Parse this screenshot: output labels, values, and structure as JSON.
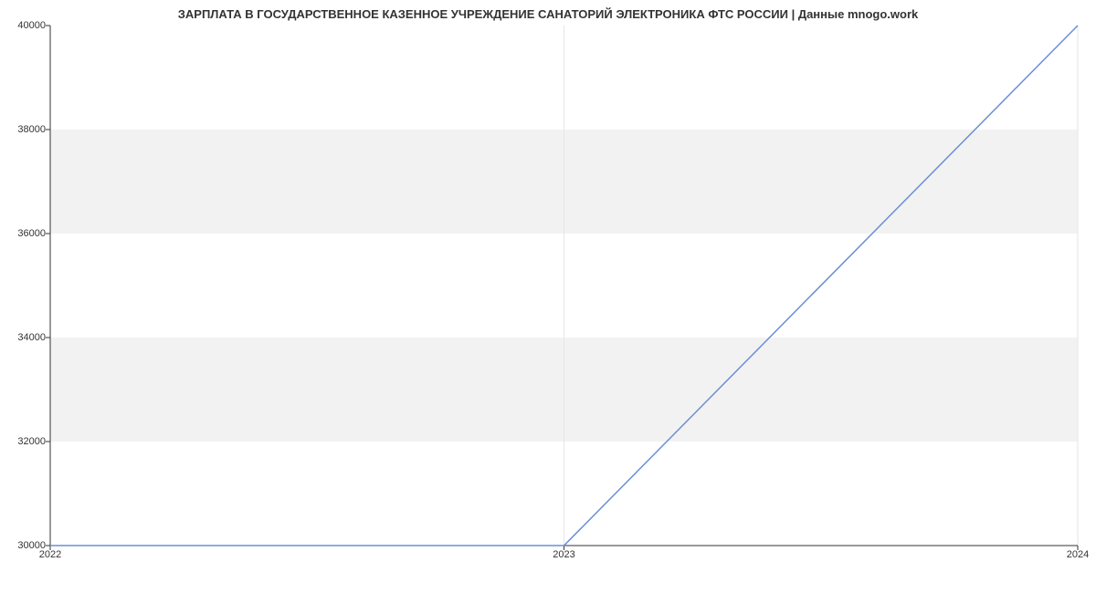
{
  "chart_data": {
    "type": "line",
    "title": "ЗАРПЛАТА В ГОСУДАРСТВЕННОЕ КАЗЕННОЕ УЧРЕЖДЕНИЕ САНАТОРИЙ ЭЛЕКТРОНИКА ФТС РОССИИ | Данные mnogo.work",
    "x": [
      2022,
      2023,
      2024
    ],
    "values": [
      30000,
      30000,
      40000
    ],
    "xlabel": "",
    "ylabel": "",
    "ylim": [
      30000,
      40000
    ],
    "xlim": [
      2022,
      2024
    ],
    "y_ticks": [
      30000,
      32000,
      34000,
      36000,
      38000,
      40000
    ],
    "x_ticks": [
      2022,
      2023,
      2024
    ],
    "line_color": "#6b8fd4",
    "band_color": "#f2f2f2"
  }
}
